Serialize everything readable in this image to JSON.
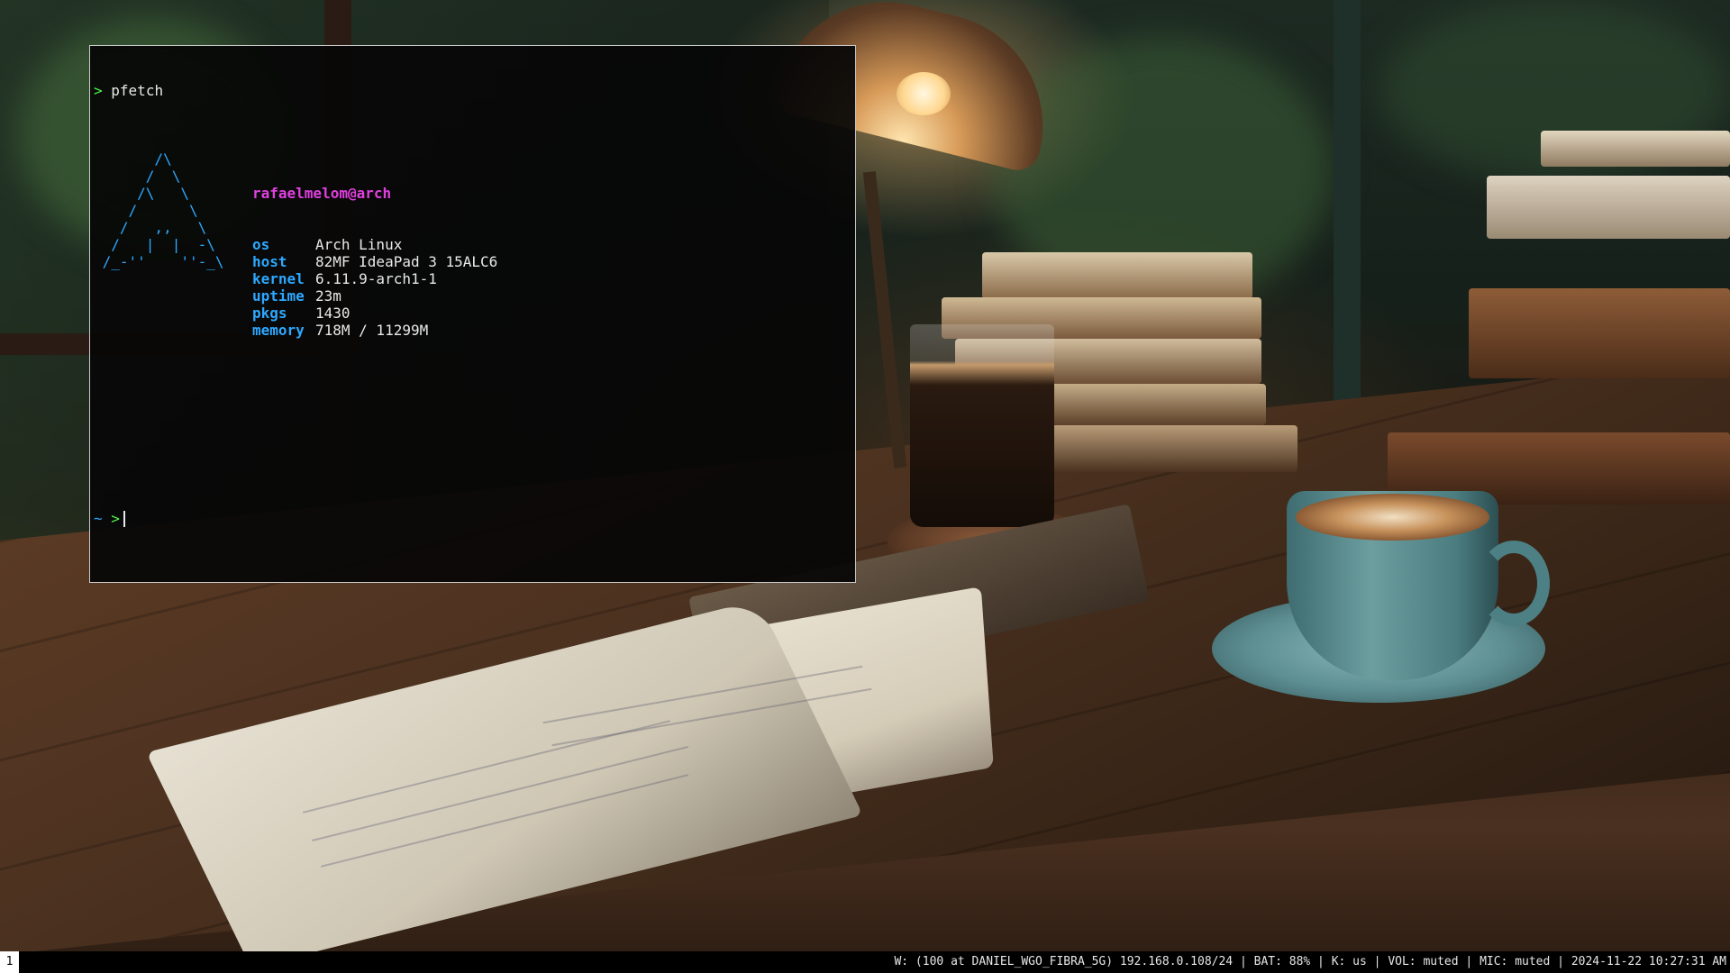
{
  "terminal": {
    "first_prompt_symbol": ">",
    "command": "pfetch",
    "ascii_logo": [
      "       /\\",
      "      /  \\",
      "     /\\   \\",
      "    /      \\",
      "   /   ,,   \\",
      "  /   |  |  -\\",
      " /_-''    ''-_\\"
    ],
    "user_host": "rafaelmelom@arch",
    "info": [
      {
        "key": "os",
        "value": "Arch Linux"
      },
      {
        "key": "host",
        "value": "82MF IdeaPad 3 15ALC6"
      },
      {
        "key": "kernel",
        "value": "6.11.9-arch1-1"
      },
      {
        "key": "uptime",
        "value": "23m"
      },
      {
        "key": "pkgs",
        "value": "1430"
      },
      {
        "key": "memory",
        "value": "718M / 11299M"
      }
    ],
    "prompt_dir": "~",
    "prompt_symbol": ">"
  },
  "statusbar": {
    "workspace": "1",
    "status": "W: (100 at DANIEL_WGO_FIBRA_5G) 192.168.0.108/24 | BAT: 88% | K: us | VOL: muted | MIC: muted | 2024-11-22 10:27:31 AM"
  },
  "colors": {
    "prompt_green": "#50fa4a",
    "info_blue": "#2ea8ff",
    "user_magenta": "#e040e0",
    "statusbar_bg": "#000000",
    "workspace_active_bg": "#ffffff"
  }
}
